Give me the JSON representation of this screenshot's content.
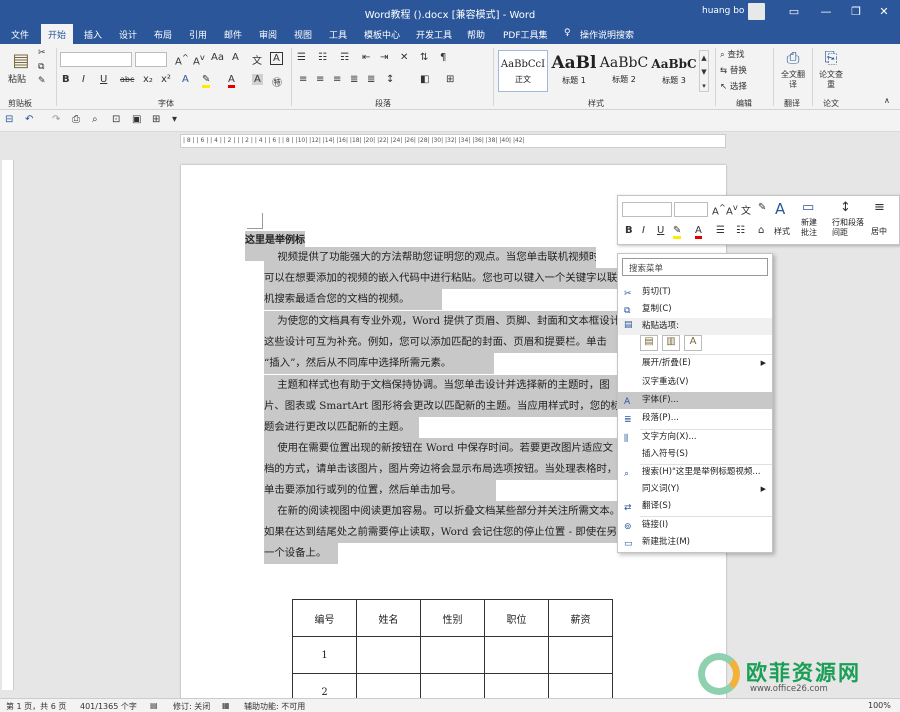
{
  "window": {
    "title": "Word教程 ().docx [兼容模式] - Word",
    "user": "huang bo"
  },
  "tabs": [
    "文件",
    "开始",
    "插入",
    "设计",
    "布局",
    "引用",
    "邮件",
    "审阅",
    "视图",
    "工具",
    "模板中心",
    "开发工具",
    "帮助",
    "PDF工具集",
    "操作说明搜索"
  ],
  "ribbon": {
    "groups": {
      "clipboard": "剪贴板",
      "font": "字体",
      "paragraph": "段落",
      "styles": "样式",
      "edit": "编辑",
      "translate": "翻译",
      "paper": "论文"
    },
    "paste": "粘贴",
    "styles": [
      {
        "sample": "AaBbCcI",
        "name": "正文"
      },
      {
        "sample": "AaBl",
        "name": "标题 1"
      },
      {
        "sample": "AaBbC",
        "name": "标题 2"
      },
      {
        "sample": "AaBbC",
        "name": "标题 3"
      }
    ],
    "edit": {
      "find": "查找",
      "replace": "替换",
      "select": "选择"
    },
    "fulltext": "全文翻译",
    "paper": "论文查重",
    "font_buttons": [
      "B",
      "I",
      "U",
      "abc",
      "x₂",
      "x²",
      "A"
    ]
  },
  "ruler_text": "| 8 |  | 6 |  | 4 |  | 2 |  |  | 2 |  | 4 |  | 6 |  | 8 |  |10|  |12|  |14|  |16|  |18|  |20|  |22|  |24|  |26|  |28|  |30|  |32|  |34|  |36|  |38|  |40|  |42|",
  "document": {
    "heading": "这里是举例标题",
    "paragraphs": [
      [
        "    视频提供了功能强大的方法帮助您证明您的观点。当您单击联机视频时，",
        "可以在想要添加的视频的嵌入代码中进行粘贴。您也可以键入一个关键字以联",
        "机搜索最适合您的文档的视频。"
      ],
      [
        "    为使您的文档具有专业外观，Word 提供了页眉、页脚、封面和文本框设计，",
        "这些设计可互为补充。例如，您可以添加匹配的封面、页眉和提要栏。单击",
        "“插入”，然后从不同库中选择所需元素。"
      ],
      [
        "    主题和样式也有助于文档保持协调。当您单击设计并选择新的主题时，图",
        "片、图表或 SmartArt 图形将会更改以匹配新的主题。当应用样式时，您的标",
        "题会进行更改以匹配新的主题。"
      ],
      [
        "    使用在需要位置出现的新按钮在 Word 中保存时间。若要更改图片适应文",
        "档的方式，请单击该图片，图片旁边将会显示布局选项按钮。当处理表格时，",
        "单击要添加行或列的位置，然后单击加号。"
      ],
      [
        "    在新的阅读视图中阅读更加容易。可以折叠文档某些部分并关注所需文本。",
        "如果在达到结尾处之前需要停止读取，Word 会记住您的停止位置 - 即使在另",
        "一个设备上。"
      ]
    ],
    "table": {
      "headers": [
        "编号",
        "姓名",
        "性别",
        "职位",
        "薪资"
      ],
      "rows": [
        [
          "1",
          "",
          "",
          "",
          ""
        ],
        [
          "2",
          "",
          "",
          "",
          ""
        ]
      ]
    }
  },
  "mini_toolbar": {
    "styles": "样式",
    "new_comment": "新建批注",
    "spacing": "行和段落间距",
    "center": "居中"
  },
  "context_menu": {
    "search_placeholder": "搜索菜单",
    "paste_options": "粘贴选项:",
    "items": [
      {
        "label": "剪切(T)",
        "icon": "cut-icon",
        "glyph": "✂"
      },
      {
        "label": "复制(C)",
        "icon": "copy-icon",
        "glyph": "⧉"
      },
      {
        "label": "展开/折叠(E)",
        "arrow": true
      },
      {
        "label": "汉字重选(V)"
      },
      {
        "label": "字体(F)...",
        "icon": "font-icon",
        "glyph": "A",
        "highlight": true
      },
      {
        "label": "段落(P)...",
        "icon": "paragraph-icon",
        "glyph": "≣"
      },
      {
        "label": "文字方向(X)...",
        "icon": "text-direction-icon",
        "glyph": "⫼"
      },
      {
        "label": "插入符号(S)"
      },
      {
        "label": "搜索(H)\"这里是举例标题视频...",
        "icon": "search-icon",
        "glyph": "⌕"
      },
      {
        "label": "同义词(Y)",
        "arrow": true
      },
      {
        "label": "翻译(S)",
        "icon": "translate-icon",
        "glyph": "⇄"
      },
      {
        "label": "链接(I)",
        "icon": "link-icon",
        "glyph": "⊚"
      },
      {
        "label": "新建批注(M)",
        "icon": "comment-icon",
        "glyph": "▭"
      }
    ]
  },
  "status": {
    "page": "第 1 页，共 6 页",
    "words": "401/1365 个字",
    "track": "修订: 关闭",
    "accessibility": "辅助功能: 不可用",
    "zoom": "100%"
  },
  "watermark": {
    "text": "欧菲资源网",
    "url": "www.office26.com"
  },
  "colors": {
    "accent": "#2b579a",
    "highlight": "#c8c8c8"
  }
}
